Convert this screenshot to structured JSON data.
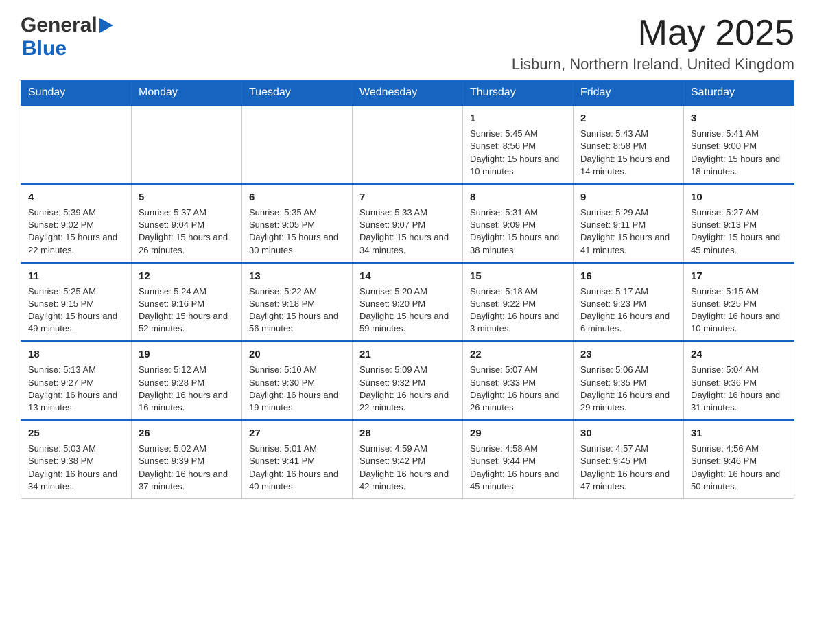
{
  "header": {
    "logo_general": "General",
    "logo_blue": "Blue",
    "month_title": "May 2025",
    "location": "Lisburn, Northern Ireland, United Kingdom"
  },
  "calendar": {
    "days": [
      "Sunday",
      "Monday",
      "Tuesday",
      "Wednesday",
      "Thursday",
      "Friday",
      "Saturday"
    ],
    "weeks": [
      [
        {
          "day": "",
          "info": ""
        },
        {
          "day": "",
          "info": ""
        },
        {
          "day": "",
          "info": ""
        },
        {
          "day": "",
          "info": ""
        },
        {
          "day": "1",
          "info": "Sunrise: 5:45 AM\nSunset: 8:56 PM\nDaylight: 15 hours and 10 minutes."
        },
        {
          "day": "2",
          "info": "Sunrise: 5:43 AM\nSunset: 8:58 PM\nDaylight: 15 hours and 14 minutes."
        },
        {
          "day": "3",
          "info": "Sunrise: 5:41 AM\nSunset: 9:00 PM\nDaylight: 15 hours and 18 minutes."
        }
      ],
      [
        {
          "day": "4",
          "info": "Sunrise: 5:39 AM\nSunset: 9:02 PM\nDaylight: 15 hours and 22 minutes."
        },
        {
          "day": "5",
          "info": "Sunrise: 5:37 AM\nSunset: 9:04 PM\nDaylight: 15 hours and 26 minutes."
        },
        {
          "day": "6",
          "info": "Sunrise: 5:35 AM\nSunset: 9:05 PM\nDaylight: 15 hours and 30 minutes."
        },
        {
          "day": "7",
          "info": "Sunrise: 5:33 AM\nSunset: 9:07 PM\nDaylight: 15 hours and 34 minutes."
        },
        {
          "day": "8",
          "info": "Sunrise: 5:31 AM\nSunset: 9:09 PM\nDaylight: 15 hours and 38 minutes."
        },
        {
          "day": "9",
          "info": "Sunrise: 5:29 AM\nSunset: 9:11 PM\nDaylight: 15 hours and 41 minutes."
        },
        {
          "day": "10",
          "info": "Sunrise: 5:27 AM\nSunset: 9:13 PM\nDaylight: 15 hours and 45 minutes."
        }
      ],
      [
        {
          "day": "11",
          "info": "Sunrise: 5:25 AM\nSunset: 9:15 PM\nDaylight: 15 hours and 49 minutes."
        },
        {
          "day": "12",
          "info": "Sunrise: 5:24 AM\nSunset: 9:16 PM\nDaylight: 15 hours and 52 minutes."
        },
        {
          "day": "13",
          "info": "Sunrise: 5:22 AM\nSunset: 9:18 PM\nDaylight: 15 hours and 56 minutes."
        },
        {
          "day": "14",
          "info": "Sunrise: 5:20 AM\nSunset: 9:20 PM\nDaylight: 15 hours and 59 minutes."
        },
        {
          "day": "15",
          "info": "Sunrise: 5:18 AM\nSunset: 9:22 PM\nDaylight: 16 hours and 3 minutes."
        },
        {
          "day": "16",
          "info": "Sunrise: 5:17 AM\nSunset: 9:23 PM\nDaylight: 16 hours and 6 minutes."
        },
        {
          "day": "17",
          "info": "Sunrise: 5:15 AM\nSunset: 9:25 PM\nDaylight: 16 hours and 10 minutes."
        }
      ],
      [
        {
          "day": "18",
          "info": "Sunrise: 5:13 AM\nSunset: 9:27 PM\nDaylight: 16 hours and 13 minutes."
        },
        {
          "day": "19",
          "info": "Sunrise: 5:12 AM\nSunset: 9:28 PM\nDaylight: 16 hours and 16 minutes."
        },
        {
          "day": "20",
          "info": "Sunrise: 5:10 AM\nSunset: 9:30 PM\nDaylight: 16 hours and 19 minutes."
        },
        {
          "day": "21",
          "info": "Sunrise: 5:09 AM\nSunset: 9:32 PM\nDaylight: 16 hours and 22 minutes."
        },
        {
          "day": "22",
          "info": "Sunrise: 5:07 AM\nSunset: 9:33 PM\nDaylight: 16 hours and 26 minutes."
        },
        {
          "day": "23",
          "info": "Sunrise: 5:06 AM\nSunset: 9:35 PM\nDaylight: 16 hours and 29 minutes."
        },
        {
          "day": "24",
          "info": "Sunrise: 5:04 AM\nSunset: 9:36 PM\nDaylight: 16 hours and 31 minutes."
        }
      ],
      [
        {
          "day": "25",
          "info": "Sunrise: 5:03 AM\nSunset: 9:38 PM\nDaylight: 16 hours and 34 minutes."
        },
        {
          "day": "26",
          "info": "Sunrise: 5:02 AM\nSunset: 9:39 PM\nDaylight: 16 hours and 37 minutes."
        },
        {
          "day": "27",
          "info": "Sunrise: 5:01 AM\nSunset: 9:41 PM\nDaylight: 16 hours and 40 minutes."
        },
        {
          "day": "28",
          "info": "Sunrise: 4:59 AM\nSunset: 9:42 PM\nDaylight: 16 hours and 42 minutes."
        },
        {
          "day": "29",
          "info": "Sunrise: 4:58 AM\nSunset: 9:44 PM\nDaylight: 16 hours and 45 minutes."
        },
        {
          "day": "30",
          "info": "Sunrise: 4:57 AM\nSunset: 9:45 PM\nDaylight: 16 hours and 47 minutes."
        },
        {
          "day": "31",
          "info": "Sunrise: 4:56 AM\nSunset: 9:46 PM\nDaylight: 16 hours and 50 minutes."
        }
      ]
    ]
  }
}
